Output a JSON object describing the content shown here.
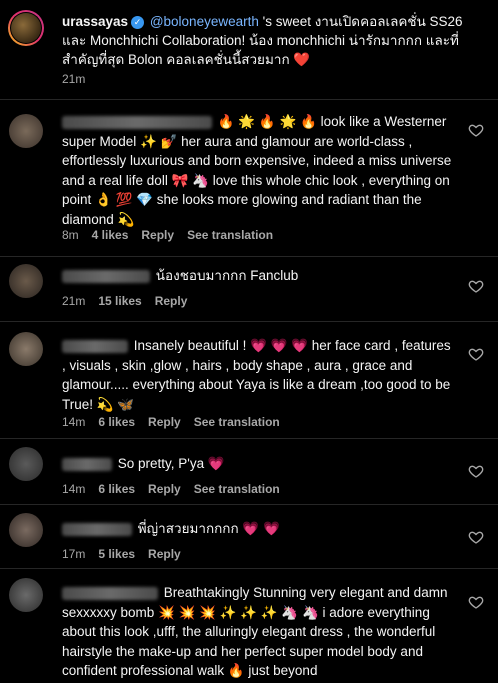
{
  "caption": {
    "username": "urassayas",
    "mention": "@boloneyewearth",
    "text": "'s sweet งานเปิดคอลเลคชั่น SS26 และ Monchhichi Collaboration! น้อง monchhichi น่ารักมากกก และที่สำคัญที่สุด Bolon คอลเลคชั่นนี้สวยมาก",
    "emoji": "❤️",
    "time": "21m"
  },
  "comments": [
    {
      "text": "🔥 🌟 🔥 🌟 🔥 look like a Westerner super Model ✨ 💅 her aura and glamour are world-class , effortlessly luxurious and born expensive, indeed a miss universe and a real life doll 🎀 🦄 love this whole chic look , everything on point 👌 💯 💎 she looks more glowing and radiant than the diamond 💫",
      "time": "8m",
      "likes": "4 likes",
      "reply": "Reply",
      "translate": "See translation"
    },
    {
      "text": "น้องชอบมากกก Fanclub",
      "time": "21m",
      "likes": "15 likes",
      "reply": "Reply",
      "translate": ""
    },
    {
      "text": "Insanely beautiful ! 💗 💗 💗 her face card , features , visuals , skin ,glow , hairs , body shape , aura , grace and glamour..... everything about Yaya is like a dream ,too good to be True! 💫 🦋",
      "time": "14m",
      "likes": "6 likes",
      "reply": "Reply",
      "translate": "See translation"
    },
    {
      "text": "So pretty, P'ya 💗",
      "time": "14m",
      "likes": "6 likes",
      "reply": "Reply",
      "translate": "See translation"
    },
    {
      "text": "พี่ญ่าสวยมากกกก 💗 💗",
      "time": "17m",
      "likes": "5 likes",
      "reply": "Reply",
      "translate": ""
    },
    {
      "text": "Breathtakingly Stunning very elegant and damn sexxxxxy bomb 💥 💥 💥 ✨ ✨ ✨ 🦄 🦄 i adore everything about this look ,ufff, the alluringly elegant dress , the wonderful hairstyle the make-up and her perfect super model body and confident professional walk 🔥 just beyond",
      "time": "",
      "likes": "",
      "reply": "",
      "translate": ""
    }
  ],
  "icons": {
    "like": "heart-outline-icon",
    "verified": "verified-badge-icon"
  },
  "colors": {
    "background": "#000000",
    "text": "#f5f5f5",
    "muted": "#a8a8a8",
    "mention": "#7ab6ff",
    "verified": "#3897f0"
  }
}
